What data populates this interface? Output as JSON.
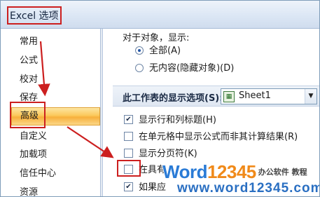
{
  "window": {
    "title": "Excel 选项"
  },
  "sidebar": {
    "items": [
      {
        "label": "常用"
      },
      {
        "label": "公式"
      },
      {
        "label": "校对"
      },
      {
        "label": "保存"
      },
      {
        "label": "高级",
        "selected": true
      },
      {
        "label": "自定义"
      },
      {
        "label": "加载项"
      },
      {
        "label": "信任中心"
      },
      {
        "label": "资源"
      }
    ]
  },
  "main": {
    "objects_section": {
      "label": "对于对象，显示:",
      "options": [
        {
          "label": "全部(A)",
          "checked": true
        },
        {
          "label": "无内容(隐藏对象)(D)",
          "checked": false
        }
      ]
    },
    "sheet_section": {
      "label": "此工作表的显示选项(S):",
      "select_value": "Sheet1"
    },
    "checkboxes": [
      {
        "label": "显示行和列标题(H)",
        "checked": true
      },
      {
        "label": "在单元格中显示公式而非其计算结果(R)",
        "checked": false
      },
      {
        "label": "显示分页符(K)",
        "checked": false
      },
      {
        "label": "在具有",
        "checked": false
      },
      {
        "label": "如果应",
        "checked": true
      }
    ]
  },
  "watermark": {
    "word": "Word",
    "num": "12345",
    "cn": "办公软件 教程",
    "url": "www.word12345.com"
  },
  "colors": {
    "annotation": "#cc1f1f",
    "selected_item": "#fbc85a",
    "accent": "#2255a6"
  }
}
